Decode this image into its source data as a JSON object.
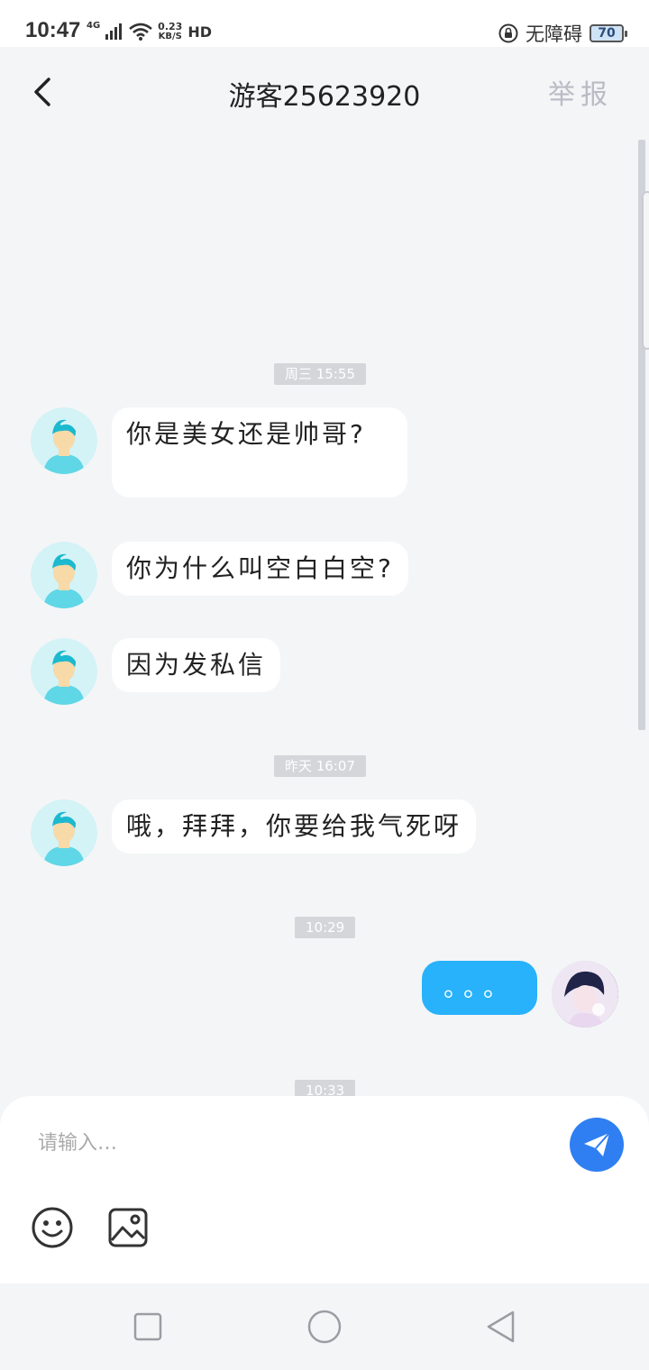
{
  "status_bar": {
    "time": "10:47",
    "network": "4G",
    "speed_value": "0.23",
    "speed_unit": "KB/S",
    "hd": "HD",
    "accessibility": "无障碍",
    "battery": "70"
  },
  "header": {
    "title": "游客25623920",
    "report": "举报"
  },
  "messages": [
    {
      "kind": "time",
      "text": "周三  15:55"
    },
    {
      "kind": "msg",
      "from": "other",
      "text": "你是美女还是帅哥?"
    },
    {
      "kind": "msg",
      "from": "other",
      "text": "你为什么叫空白白空?"
    },
    {
      "kind": "msg",
      "from": "other",
      "text": "因为发私信"
    },
    {
      "kind": "time",
      "text": "昨天  16:07"
    },
    {
      "kind": "msg",
      "from": "other",
      "text": "哦，拜拜，你要给我气死呀"
    },
    {
      "kind": "time",
      "text": "10:29"
    },
    {
      "kind": "msg",
      "from": "me",
      "text": "。。。"
    },
    {
      "kind": "time",
      "text": "10:33"
    }
  ],
  "composer": {
    "placeholder": "请输入…"
  },
  "colors": {
    "my_bubble": "#27b2fb",
    "send_button": "#2f7ff2",
    "background": "#f4f5f7"
  },
  "icons": {
    "back": "chevron-left-icon",
    "send": "paper-plane-icon",
    "emoji": "smiley-icon",
    "image": "image-icon",
    "nav_recent": "square-icon",
    "nav_home": "circle-icon",
    "nav_back": "triangle-icon"
  }
}
